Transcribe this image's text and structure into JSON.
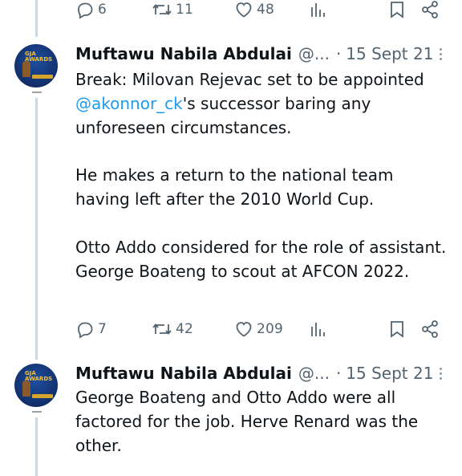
{
  "top_actions": {
    "replies": "6",
    "retweets": "11",
    "likes": "48"
  },
  "tweets": [
    {
      "author_name": "Muftawu Nabila Abdulai",
      "handle": "@...",
      "separator": "·",
      "date": "15 Sept 21",
      "text_before_mention": "Break: Milovan Rejevac set to be appointed",
      "mention": "@akonnor_ck",
      "text_after_mention": "'s successor baring any unforeseen circumstances.",
      "paragraph2": "He makes a return to the national team having left after the 2010 World Cup.",
      "paragraph3": "Otto Addo considered for the role of assistant. George Boateng to scout at AFCON 2022.",
      "replies": "7",
      "retweets": "42",
      "likes": "209"
    },
    {
      "author_name": "Muftawu Nabila Abdulai",
      "handle": "@...",
      "separator": "·",
      "date": "15 Sept 21",
      "text": "George Boateng and Otto Addo were all factored for the job. Herve Renard was the other."
    }
  ],
  "avatar": {
    "title_line1": "GJA",
    "title_line2": "AWARDS"
  },
  "colors": {
    "link": "#1d9bf0",
    "muted": "#536471",
    "thread_line": "#cfd9de"
  },
  "icons": [
    "reply-icon",
    "retweet-icon",
    "like-icon",
    "views-icon",
    "bookmark-icon",
    "share-icon",
    "more-icon"
  ]
}
